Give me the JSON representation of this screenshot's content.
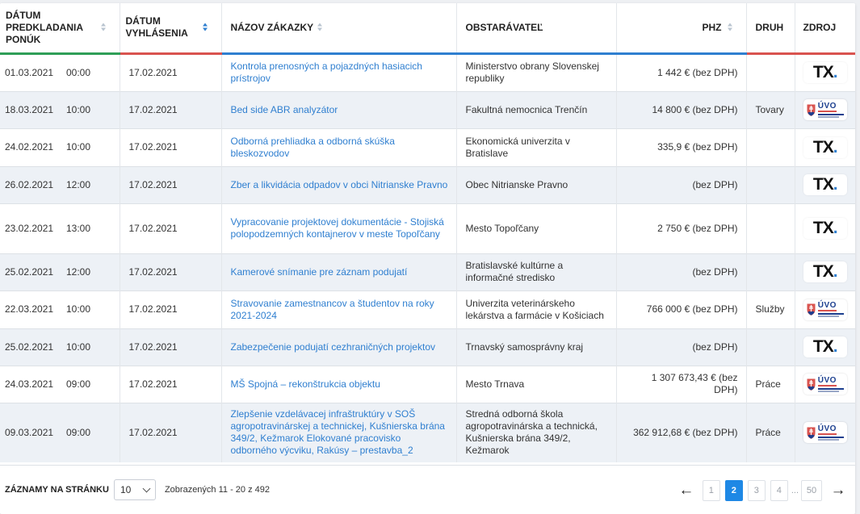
{
  "headers": {
    "datum_predkladania": "DÁTUM PREDKLADANIA PONÚK",
    "datum_vyhlasenia": "DÁTUM VYHLÁSENIA",
    "nazov": "NÁZOV ZÁKAZKY",
    "obstaravatel": "OBSTARÁVATEĽ",
    "phz": "PHZ",
    "druh": "DRUH",
    "zdroj": "ZDROJ"
  },
  "colors": {
    "accent": "#2f7fd0",
    "green": "#2f9e57",
    "red": "#d9534f",
    "row_alt": "#edf1f6"
  },
  "rows": [
    {
      "date": "01.03.2021",
      "time": "00:00",
      "published": "17.02.2021",
      "title": "Kontrola prenosných a pojazdných hasiacich prístrojov",
      "buyer": "Ministerstvo obrany Slovenskej republiky",
      "phz": "1 442 € (bez DPH)",
      "type": "",
      "source": "tx"
    },
    {
      "date": "18.03.2021",
      "time": "10:00",
      "published": "17.02.2021",
      "title": "Bed side ABR analyzátor",
      "buyer": "Fakultná nemocnica Trenčín",
      "phz": "14 800 € (bez DPH)",
      "type": "Tovary",
      "source": "uvo"
    },
    {
      "date": "24.02.2021",
      "time": "10:00",
      "published": "17.02.2021",
      "title": "Odborná prehliadka a odborná skúška bleskozvodov",
      "buyer": "Ekonomická univerzita v Bratislave",
      "phz": "335,9 € (bez DPH)",
      "type": "",
      "source": "tx"
    },
    {
      "date": "26.02.2021",
      "time": "12:00",
      "published": "17.02.2021",
      "title": "Zber a likvidácia odpadov v obci Nitrianske Pravno",
      "buyer": "Obec Nitrianske Pravno",
      "phz": "(bez DPH)",
      "type": "",
      "source": "tx"
    },
    {
      "date": "23.02.2021",
      "time": "13:00",
      "published": "17.02.2021",
      "title": "Vypracovanie projektovej dokumentácie - Stojiská polopodzemných kontajnerov v meste Topoľčany",
      "buyer": "Mesto Topoľčany",
      "phz": "2 750 € (bez DPH)",
      "type": "",
      "source": "tx"
    },
    {
      "date": "25.02.2021",
      "time": "12:00",
      "published": "17.02.2021",
      "title": "Kamerové snímanie pre záznam podujatí",
      "buyer": "Bratislavské kultúrne a informačné stredisko",
      "phz": "(bez DPH)",
      "type": "",
      "source": "tx"
    },
    {
      "date": "22.03.2021",
      "time": "10:00",
      "published": "17.02.2021",
      "title": "Stravovanie zamestnancov a študentov na roky 2021-2024",
      "buyer": "Univerzita veterinárskeho lekárstva a farmácie v Košiciach",
      "phz": "766 000 € (bez DPH)",
      "type": "Služby",
      "source": "uvo"
    },
    {
      "date": "25.02.2021",
      "time": "10:00",
      "published": "17.02.2021",
      "title": "Zabezpečenie podujatí cezhraničných projektov",
      "buyer": "Trnavský samosprávny kraj",
      "phz": "(bez DPH)",
      "type": "",
      "source": "tx"
    },
    {
      "date": "24.03.2021",
      "time": "09:00",
      "published": "17.02.2021",
      "title": "MŠ Spojná – rekonštrukcia objektu",
      "buyer": "Mesto Trnava",
      "phz": "1 307 673,43 € (bez DPH)",
      "type": "Práce",
      "source": "uvo"
    },
    {
      "date": "09.03.2021",
      "time": "09:00",
      "published": "17.02.2021",
      "title": "Zlepšenie vzdelávacej infraštruktúry v SOŠ agropotravinárskej a technickej, Kušnierska brána 349/2, Kežmarok Elokované pracovisko odborného výcviku, Rakúsy – prestavba_2",
      "buyer": "Stredná odborná škola agropotravinárska a technická, Kušnierska brána 349/2, Kežmarok",
      "phz": "362 912,68 € (bez DPH)",
      "type": "Práce",
      "source": "uvo"
    }
  ],
  "logos": {
    "tx": "TX",
    "tx_dot": ".",
    "uvo": "ÚVO"
  },
  "footer": {
    "per_page_label": "ZÁZNAMY NA STRÁNKU",
    "per_page_value": "10",
    "shown_text": "Zobrazených 11 - 20 z 492",
    "pages": [
      "1",
      "2",
      "3",
      "4"
    ],
    "active_page": "2",
    "ellipsis": "...",
    "last_page": "50",
    "prev_icon": "arrow-left-icon",
    "next_icon": "arrow-right-icon"
  }
}
